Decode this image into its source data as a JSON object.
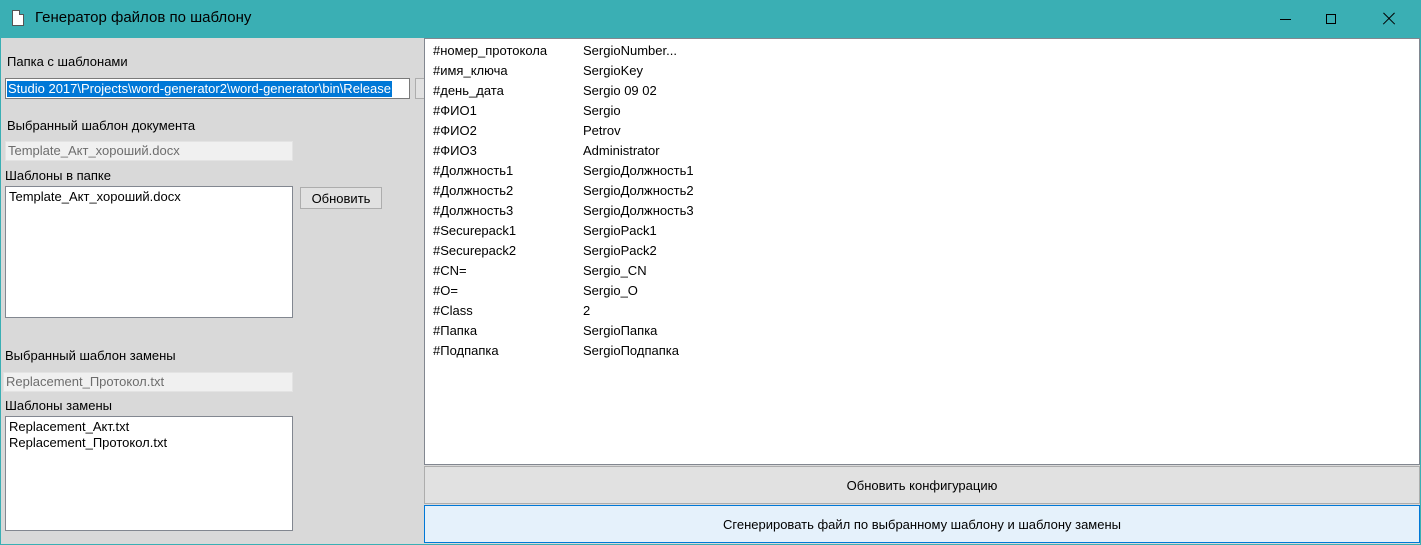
{
  "window": {
    "title": "Генератор файлов по шаблону"
  },
  "left": {
    "templates_folder_label": "Папка с шаблонами",
    "templates_folder_value": "Studio 2017\\Projects\\word-generator2\\word-generator\\bin\\Release",
    "selected_doc_template_label": "Выбранный шаблон документа",
    "selected_doc_template_value": "Template_Акт_хороший.docx",
    "folder_templates_label": "Шаблоны в папке",
    "folder_templates": [
      "Template_Акт_хороший.docx"
    ],
    "refresh_button": "Обновить",
    "selected_replacement_label": "Выбранный шаблон замены",
    "selected_replacement_value": "Replacement_Протокол.txt",
    "replacement_templates_label": "Шаблоны замены",
    "replacement_templates": [
      "Replacement_Акт.txt",
      "Replacement_Протокол.txt"
    ]
  },
  "config": {
    "rows": [
      {
        "key": "#номер_протокола",
        "value": "SergioNumber..."
      },
      {
        "key": "#имя_ключа",
        "value": "SergioKey"
      },
      {
        "key": "#день_дата",
        "value": "Sergio 09 02"
      },
      {
        "key": "#ФИО1",
        "value": "Sergio"
      },
      {
        "key": "#ФИО2",
        "value": "Petrov"
      },
      {
        "key": "#ФИО3",
        "value": "Administrator"
      },
      {
        "key": "#Должность1",
        "value": "SergioДолжность1"
      },
      {
        "key": "#Должность2",
        "value": "SergioДолжность2"
      },
      {
        "key": "#Должность3",
        "value": "SergioДолжность3"
      },
      {
        "key": "#Securepack1",
        "value": "SergioPack1"
      },
      {
        "key": "#Securepack2",
        "value": "SergioPack2"
      },
      {
        "key": "#CN=",
        "value": "Sergio_CN"
      },
      {
        "key": "#O=",
        "value": "Sergio_O"
      },
      {
        "key": "#Class",
        "value": "2"
      },
      {
        "key": "#Папка",
        "value": "SergioПапка"
      },
      {
        "key": "#Подпапка",
        "value": "SergioПодпапка"
      }
    ],
    "update_button": "Обновить конфигурацию",
    "generate_button": "Сгенерировать файл по выбранному шаблону и шаблону замены"
  }
}
